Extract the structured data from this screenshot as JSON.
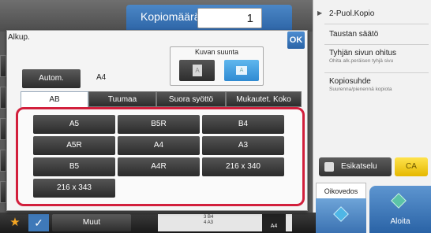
{
  "header": {
    "copies_label": "Kopiomäärä",
    "copies_value": "1"
  },
  "right_panel": {
    "items": [
      {
        "label": "2-Puol.Kopio",
        "sub": ""
      },
      {
        "label": "Taustan säätö",
        "sub": ""
      },
      {
        "label": "Tyhjän sivun ohitus",
        "sub": "Ohita alk.peräisen tyhjä sivu"
      },
      {
        "label": "Kopiosuhde",
        "sub": "Suurenna/pienennä kopiota"
      }
    ],
    "preview_label": "Esikatselu",
    "ca_label": "CA",
    "oikovedos_label": "Oikovedos",
    "start_label": "Aloita"
  },
  "dialog": {
    "title": "Alkup.",
    "ok_label": "OK",
    "orientation_label": "Kuvan suunta",
    "orientation_portrait_glyph": "A",
    "orientation_landscape_glyph": "A",
    "autom_label": "Autom.",
    "current_size": "A4",
    "tabs": [
      "AB",
      "Tuumaa",
      "Suora syöttö",
      "Mukautet. Koko"
    ],
    "active_tab": "AB",
    "sizes": [
      "A5",
      "B5R",
      "B4",
      "A5R",
      "A4",
      "A3",
      "B5",
      "A4R",
      "216 x 340",
      "216 x 343"
    ]
  },
  "bottom_bar": {
    "star_glyph": "★",
    "check_glyph": "✓",
    "muut_label": "Muut",
    "tray_lines": [
      "3   B4",
      "4   A3"
    ],
    "paper_label": "A4"
  },
  "colors": {
    "accent_blue": "#2d64a6",
    "highlight_red": "#d21f3c",
    "ca_yellow": "#f2cb1d"
  }
}
